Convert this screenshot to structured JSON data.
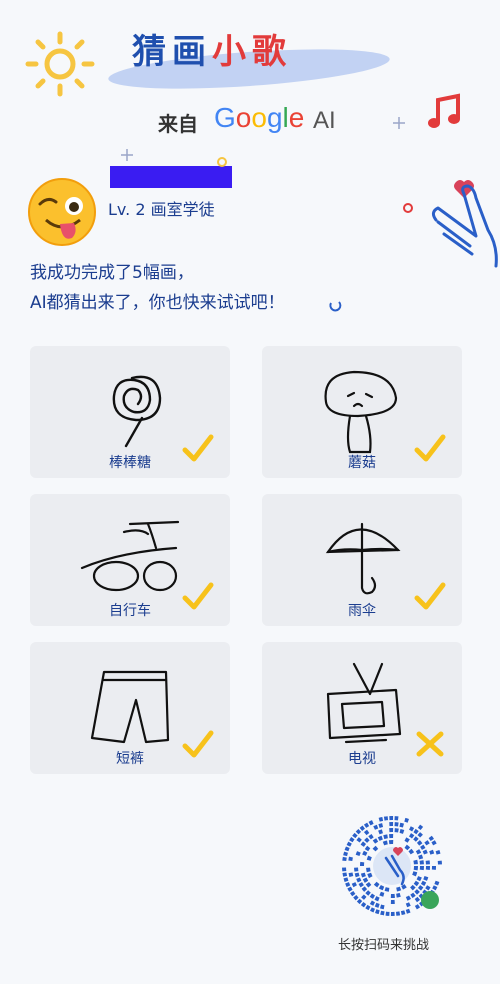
{
  "header": {
    "title_main": "猜画",
    "title_accent": "小歌",
    "from_label": "来自",
    "brand_letters": [
      "G",
      "o",
      "o",
      "g",
      "l",
      "e"
    ],
    "brand_suffix": "AI"
  },
  "user": {
    "level": "Lv. 2 画室学徒",
    "avatar_icon": "winking-face-emoji"
  },
  "message": {
    "line1": "我成功完成了5幅画，",
    "line2": "AI都猜出来了，你也快来试试吧！"
  },
  "drawings": [
    {
      "label": "棒棒糖",
      "result": "correct"
    },
    {
      "label": "蘑菇",
      "result": "correct"
    },
    {
      "label": "自行车",
      "result": "correct"
    },
    {
      "label": "雨伞",
      "result": "correct"
    },
    {
      "label": "短裤",
      "result": "correct"
    },
    {
      "label": "电视",
      "result": "wrong"
    }
  ],
  "qr": {
    "label": "长按扫码来挑战",
    "icon": "hand-heart-icon"
  },
  "colors": {
    "title_blue": "#1f4fae",
    "title_red": "#e23b3b",
    "check_yellow": "#f7c21b",
    "label_blue": "#1b3d8f",
    "card_bg": "#ebedf1",
    "qr_blue": "#2a5fc8"
  }
}
